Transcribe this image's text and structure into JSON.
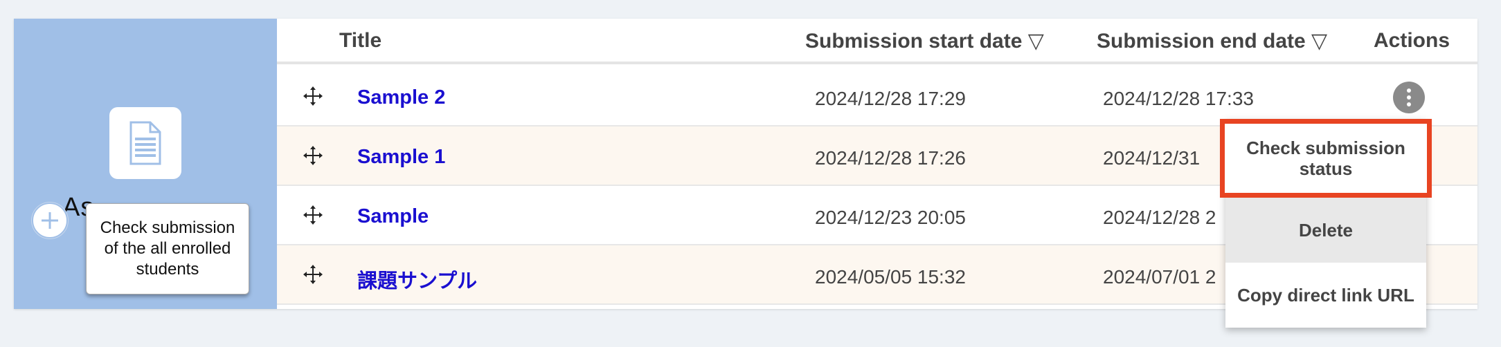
{
  "sidebar": {
    "label": "As",
    "tooltip": "Check submission of the all enrolled students"
  },
  "table": {
    "headers": {
      "title": "Title",
      "start": "Submission start date ▽",
      "end": "Submission end date ▽",
      "actions": "Actions"
    },
    "rows": [
      {
        "title": "Sample 2",
        "start": "2024/12/28 17:29",
        "end": "2024/12/28 17:33"
      },
      {
        "title": "Sample 1",
        "start": "2024/12/28 17:26",
        "end": "2024/12/31"
      },
      {
        "title": "Sample",
        "start": "2024/12/23 20:05",
        "end": "2024/12/28 2"
      },
      {
        "title": "課題サンプル",
        "start": "2024/05/05 15:32",
        "end": "2024/07/01 2"
      }
    ]
  },
  "actions_menu": {
    "check_status": "Check submission status",
    "delete": "Delete",
    "copy_link": "Copy direct link URL"
  },
  "colors": {
    "sidebar_bg": "#a0bfe7",
    "link": "#1a0fd0",
    "highlight_border": "#e84422",
    "alt_row": "#fdf7f0"
  }
}
